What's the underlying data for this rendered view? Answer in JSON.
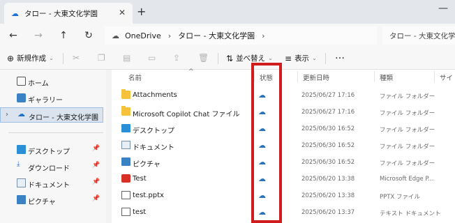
{
  "tab": {
    "title": "タロー - 大東文化学園",
    "close": "✕",
    "new": "+"
  },
  "window": {
    "minimize": "—"
  },
  "nav": {
    "back": "←",
    "forward": "→",
    "up": "↑",
    "refresh": "↻",
    "breadcrumb": [
      "OneDrive",
      "タロー - 大東文化学園"
    ],
    "separator": "›",
    "search_placeholder": "タロー - 大東文化学園の検索"
  },
  "commands": {
    "new_label": "新規作成",
    "sort_label": "並べ替え",
    "view_label": "表示",
    "more": "…"
  },
  "sidebar": {
    "items": [
      {
        "label": "ホーム",
        "icon": "home-icon"
      },
      {
        "label": "ギャラリー",
        "icon": "gallery-icon"
      },
      {
        "label": "タロー - 大東文化学園",
        "icon": "cloud-icon",
        "selected": true,
        "expander": "›"
      },
      {
        "label": "デスクトップ",
        "icon": "desktop-icon",
        "pin": "📌"
      },
      {
        "label": "ダウンロード",
        "icon": "download-icon",
        "pin": "📌"
      },
      {
        "label": "ドキュメント",
        "icon": "document-icon",
        "pin": "📌"
      },
      {
        "label": "ピクチャ",
        "icon": "pictures-icon",
        "pin": "📌"
      }
    ]
  },
  "columns": {
    "name": "名前",
    "status": "状態",
    "modified": "更新日時",
    "type": "種類",
    "size": "サイ",
    "sort_indicator": "^"
  },
  "files": [
    {
      "name": "Attachments",
      "icon": "folder-icon",
      "status": "☁",
      "modified": "2025/06/27 17:16",
      "type": "ファイル フォルダー"
    },
    {
      "name": "Microsoft Copilot Chat ファイル",
      "icon": "folder-icon",
      "status": "☁",
      "modified": "2025/06/27 17:16",
      "type": "ファイル フォルダー"
    },
    {
      "name": "デスクトップ",
      "icon": "desktop-icon",
      "status": "☁",
      "modified": "2025/06/30 16:52",
      "type": "ファイル フォルダー"
    },
    {
      "name": "ドキュメント",
      "icon": "document-icon",
      "status": "☁",
      "modified": "2025/06/30 16:52",
      "type": "ファイル フォルダー"
    },
    {
      "name": "ピクチャ",
      "icon": "pictures-icon",
      "status": "☁",
      "modified": "2025/06/30 16:52",
      "type": "ファイル フォルダー"
    },
    {
      "name": "Test",
      "icon": "pdf-icon",
      "status": "☁",
      "modified": "2025/06/20 13:38",
      "type": "Microsoft Edge P..."
    },
    {
      "name": "test.pptx",
      "icon": "file-icon",
      "status": "☁",
      "modified": "2025/06/20 13:38",
      "type": "PPTX ファイル"
    },
    {
      "name": "test",
      "icon": "file-icon",
      "status": "☁",
      "modified": "2025/06/20 13:37",
      "type": "テキスト ドキュメント"
    }
  ],
  "colors": {
    "highlight_box": "#d01c1c",
    "cloud_status": "#2a6fb8",
    "selected_bg": "#dbe4ee"
  }
}
